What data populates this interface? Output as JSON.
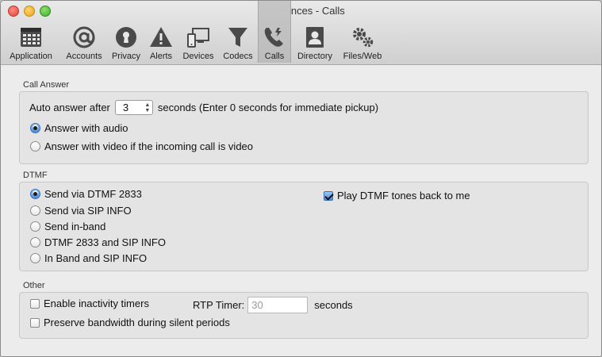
{
  "window": {
    "title": "Preferences - Calls"
  },
  "toolbar": {
    "items": [
      {
        "label": "Application",
        "icon": "calendar-grid-icon"
      },
      {
        "label": "Accounts",
        "icon": "at-sign-icon"
      },
      {
        "label": "Privacy",
        "icon": "keyhole-icon"
      },
      {
        "label": "Alerts",
        "icon": "warning-icon"
      },
      {
        "label": "Devices",
        "icon": "devices-icon"
      },
      {
        "label": "Codecs",
        "icon": "funnel-icon"
      },
      {
        "label": "Calls",
        "icon": "phone-icon",
        "selected": true
      },
      {
        "label": "Directory",
        "icon": "contact-card-icon"
      },
      {
        "label": "Files/Web",
        "icon": "gears-icon"
      }
    ]
  },
  "call_answer": {
    "section_label": "Call Answer",
    "auto_answer_prefix": "Auto answer after",
    "auto_answer_value": "3",
    "auto_answer_suffix": "seconds (Enter 0 seconds for immediate pickup)",
    "options": [
      {
        "label": "Answer with audio",
        "selected": true
      },
      {
        "label": "Answer with video if the incoming call is video",
        "selected": false
      }
    ]
  },
  "dtmf": {
    "section_label": "DTMF",
    "options": [
      {
        "label": "Send via DTMF 2833",
        "selected": true
      },
      {
        "label": "Send via SIP INFO",
        "selected": false
      },
      {
        "label": "Send in-band",
        "selected": false
      },
      {
        "label": "DTMF 2833 and SIP INFO",
        "selected": false
      },
      {
        "label": "In Band and SIP INFO",
        "selected": false
      }
    ],
    "play_tones": {
      "label": "Play DTMF tones back to me",
      "checked": true
    }
  },
  "other": {
    "section_label": "Other",
    "inactivity": {
      "label": "Enable inactivity timers",
      "checked": false
    },
    "rtp_timer_label": "RTP Timer:",
    "rtp_timer_placeholder": "30",
    "rtp_timer_unit": "seconds",
    "bandwidth": {
      "label": "Preserve bandwidth during silent periods",
      "checked": false
    }
  }
}
